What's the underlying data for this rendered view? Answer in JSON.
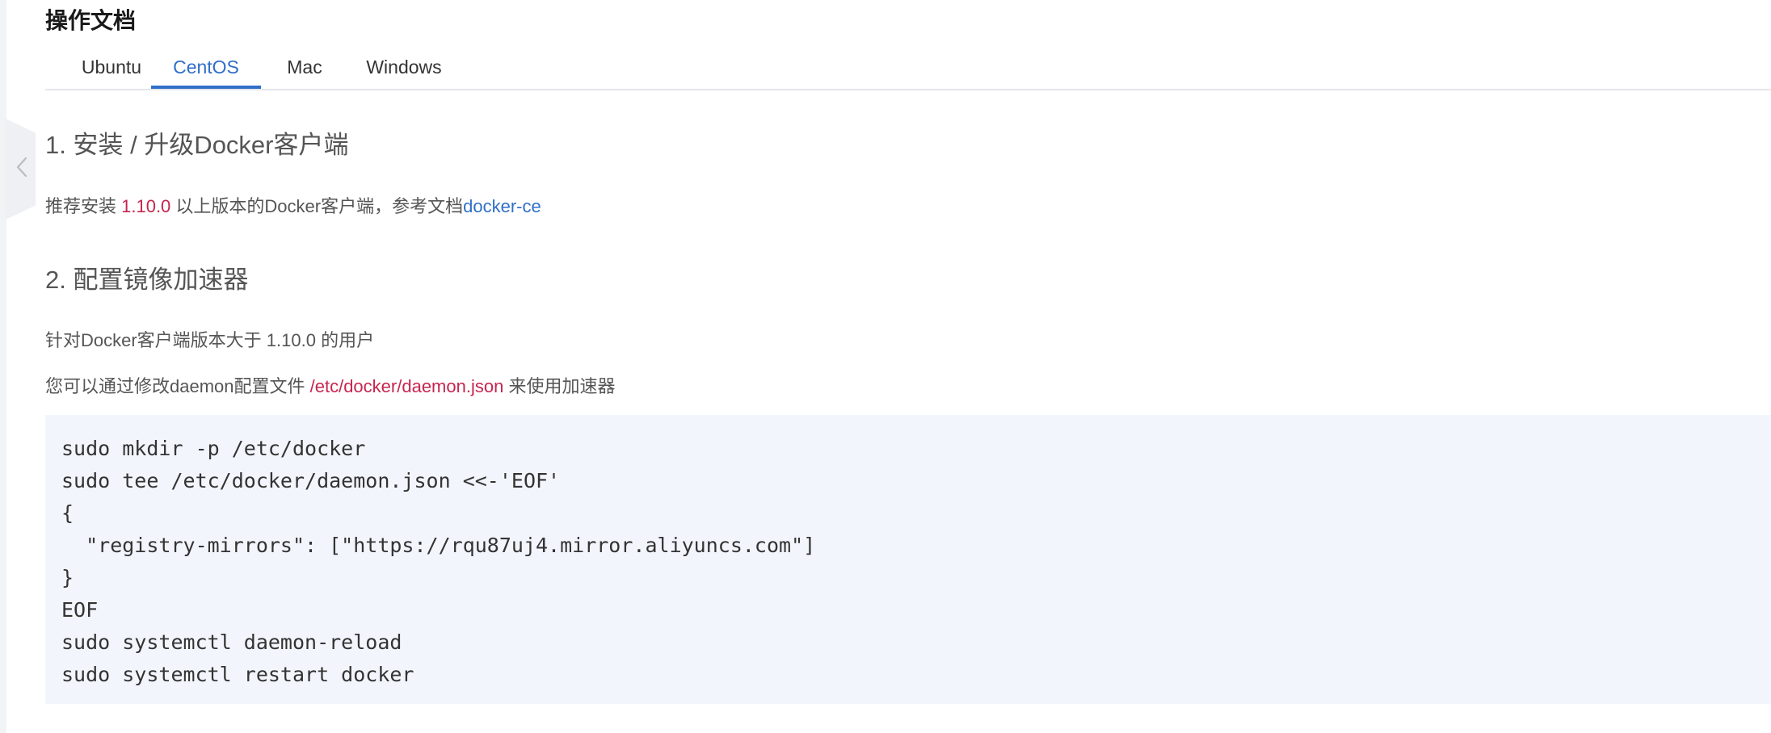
{
  "page": {
    "title": "操作文档"
  },
  "tabs": [
    {
      "label": "Ubuntu",
      "active": false
    },
    {
      "label": "CentOS",
      "active": true
    },
    {
      "label": "Mac",
      "active": false
    },
    {
      "label": "Windows",
      "active": false
    }
  ],
  "section1": {
    "heading": "1. 安装 / 升级Docker客户端",
    "text_prefix": "推荐安装 ",
    "version": "1.10.0",
    "text_middle": " 以上版本的Docker客户端，参考文档",
    "link_label": "docker-ce"
  },
  "section2": {
    "heading": "2. 配置镜像加速器",
    "line1": "针对Docker客户端版本大于 1.10.0 的用户",
    "line2_prefix": "您可以通过修改daemon配置文件 ",
    "config_path": "/etc/docker/daemon.json",
    "line2_suffix": " 来使用加速器"
  },
  "code": {
    "lines": [
      "sudo mkdir -p /etc/docker",
      "sudo tee /etc/docker/daemon.json <<-'EOF'",
      "{",
      "  \"registry-mirrors\": [\"https://rqu87uj4.mirror.aliyuncs.com\"]",
      "}",
      "EOF",
      "sudo systemctl daemon-reload",
      "sudo systemctl restart docker"
    ]
  },
  "icons": {
    "collapse": "chevron-left-icon"
  },
  "colors": {
    "accent_blue": "#2f6fc9",
    "highlight_red": "#c7254e",
    "code_background": "#f2f6fc"
  }
}
